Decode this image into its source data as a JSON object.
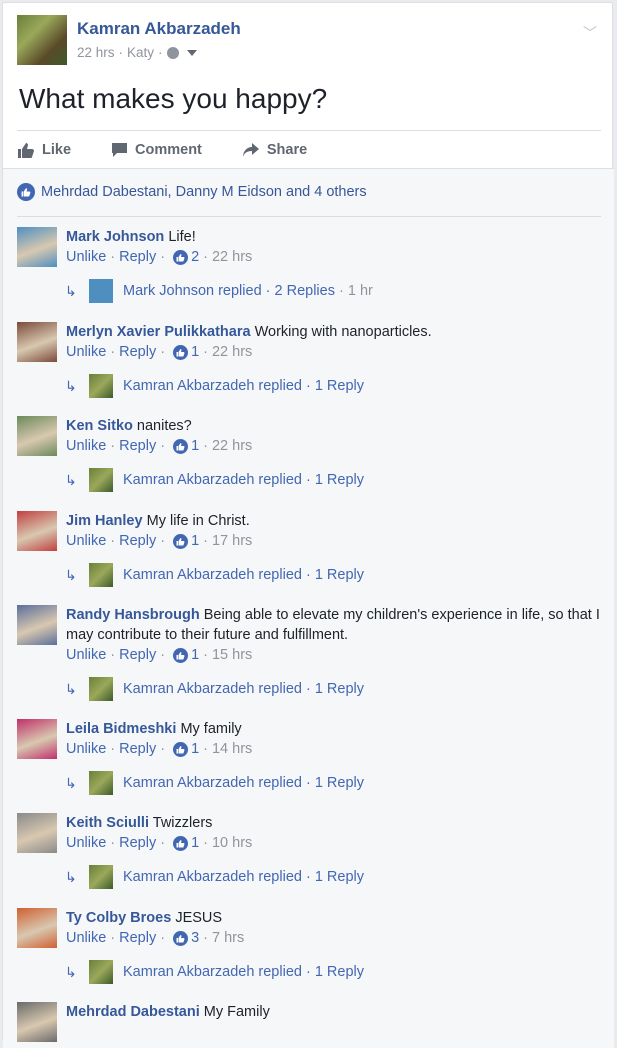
{
  "post": {
    "author": "Kamran Akbarzadeh",
    "time": "22 hrs",
    "location": "Katy",
    "text": "What makes you happy?",
    "actions": {
      "like": "Like",
      "comment": "Comment",
      "share": "Share"
    },
    "likes_summary": "Mehrdad Dabestani, Danny M Eidson and 4 others"
  },
  "comments": [
    {
      "name": "Mark Johnson",
      "text": "Life!",
      "unlike": "Unlike",
      "reply": "Reply",
      "likes": "2",
      "time": "22 hrs",
      "replied": "Mark Johnson replied · 2 Replies",
      "replied_time": "1 hr",
      "avatar_color": "#4f8fc0"
    },
    {
      "name": "Merlyn Xavier Pulikkathara",
      "text": "Working with nanoparticles.",
      "unlike": "Unlike",
      "reply": "Reply",
      "likes": "1",
      "time": "22 hrs",
      "replied": "Kamran Akbarzadeh replied · 1 Reply",
      "replied_time": "",
      "avatar_color": "#7a4a3a"
    },
    {
      "name": "Ken Sitko",
      "text": "nanites?",
      "unlike": "Unlike",
      "reply": "Reply",
      "likes": "1",
      "time": "22 hrs",
      "replied": "Kamran Akbarzadeh replied · 1 Reply",
      "replied_time": "",
      "avatar_color": "#6b8a5a"
    },
    {
      "name": "Jim Hanley",
      "text": "My life in Christ.",
      "unlike": "Unlike",
      "reply": "Reply",
      "likes": "1",
      "time": "17 hrs",
      "replied": "Kamran Akbarzadeh replied · 1 Reply",
      "replied_time": "",
      "avatar_color": "#c04040"
    },
    {
      "name": "Randy Hansbrough",
      "text": "Being able to elevate my children's experience in life, so that I may contribute to their future and fulfillment.",
      "unlike": "Unlike",
      "reply": "Reply",
      "likes": "1",
      "time": "15 hrs",
      "replied": "Kamran Akbarzadeh replied · 1 Reply",
      "replied_time": "",
      "avatar_color": "#5a6f9a"
    },
    {
      "name": "Leila Bidmeshki",
      "text": "My family",
      "unlike": "Unlike",
      "reply": "Reply",
      "likes": "1",
      "time": "14 hrs",
      "replied": "Kamran Akbarzadeh replied · 1 Reply",
      "replied_time": "",
      "avatar_color": "#c0306a"
    },
    {
      "name": "Keith Sciulli",
      "text": "Twizzlers",
      "unlike": "Unlike",
      "reply": "Reply",
      "likes": "1",
      "time": "10 hrs",
      "replied": "Kamran Akbarzadeh replied · 1 Reply",
      "replied_time": "",
      "avatar_color": "#8a8a8a"
    },
    {
      "name": "Ty Colby Broes",
      "text": "JESUS",
      "unlike": "Unlike",
      "reply": "Reply",
      "likes": "3",
      "time": "7 hrs",
      "replied": "Kamran Akbarzadeh replied · 1 Reply",
      "replied_time": "",
      "avatar_color": "#d06030"
    },
    {
      "name": "Mehrdad Dabestani",
      "text": "My Family",
      "avatar_color": "#6a6a6a"
    }
  ],
  "colors": {
    "link": "#365899",
    "accent": "#4267b2",
    "muted": "#90949c"
  }
}
